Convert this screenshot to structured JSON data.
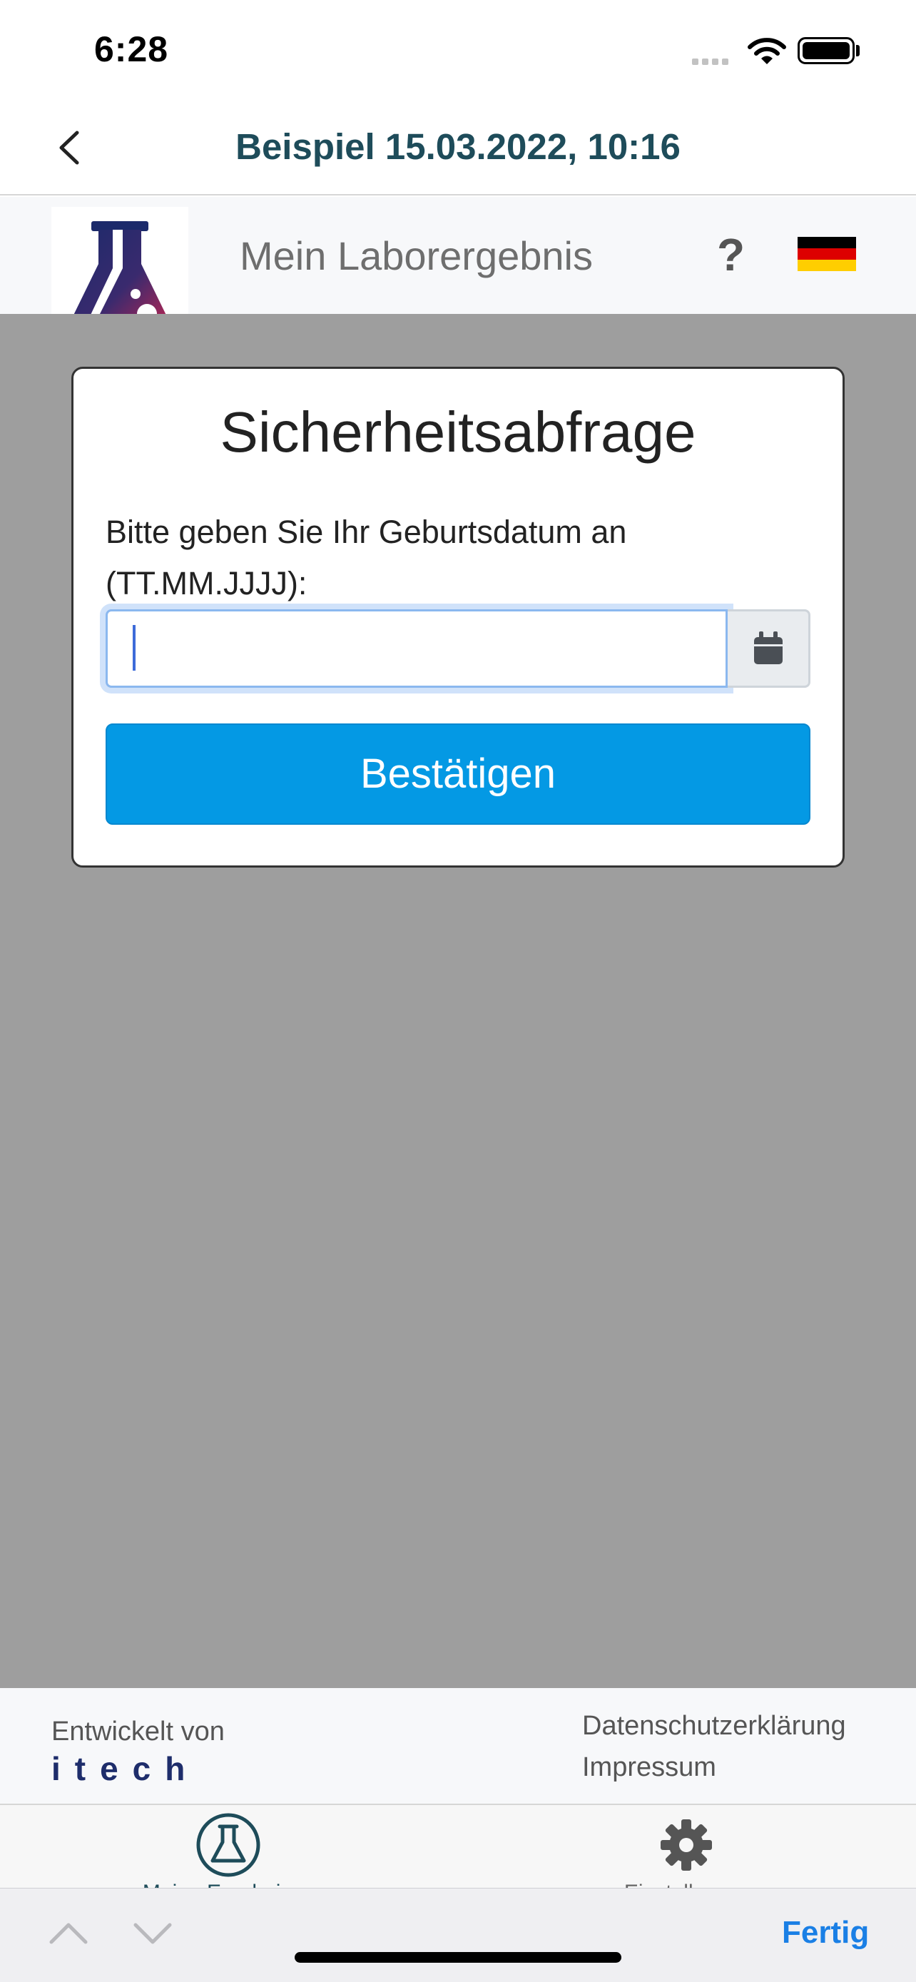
{
  "status_bar": {
    "time": "6:28",
    "icons": [
      "signal-icon",
      "wifi-icon",
      "battery-icon"
    ]
  },
  "nav": {
    "title": "Beispiel 15.03.2022, 10:16",
    "back_icon": "chevron-left-icon"
  },
  "header": {
    "title": "Mein Laborergebnis",
    "help_label": "?",
    "logo_icon": "flask-icon",
    "language_icon": "german-flag-icon"
  },
  "security_card": {
    "title": "Sicherheitsabfrage",
    "label": "Bitte geben Sie Ihr Geburtsdatum an (TT.MM.JJJJ):",
    "date_value": "",
    "calendar_icon": "calendar-icon",
    "confirm_label": "Bestätigen"
  },
  "footer": {
    "developed_by": "Entwickelt von",
    "developer_brand": "itech",
    "privacy_link": "Datenschutzerklärung",
    "imprint_link": "Impressum"
  },
  "tabs": [
    {
      "label": "Meine Ergebnisse",
      "icon": "flask-icon"
    },
    {
      "label": "Einstellungen",
      "icon": "gear-icon"
    }
  ],
  "keyboard_accessory": {
    "prev_icon": "chevron-up-icon",
    "next_icon": "chevron-down-icon",
    "done_label": "Fertig"
  },
  "colors": {
    "accent": "#0499e4",
    "nav_title": "#1e4c5a",
    "content_background": "#9e9e9e",
    "done": "#1a7fe5"
  }
}
